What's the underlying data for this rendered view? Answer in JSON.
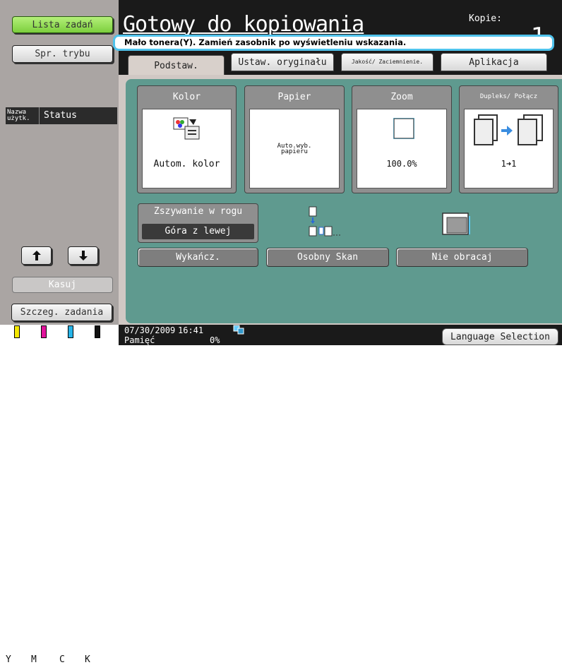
{
  "sidebar": {
    "job_list_label": "Lista zadań",
    "mode_check_label": "Spr. trybu",
    "user_col_label": "Nazwa użytk.",
    "status_col_label": "Status",
    "delete_label": "Kasuj",
    "job_details_label": "Szczeg. zadania",
    "toner": [
      {
        "letter": "Y",
        "color": "#f5e800"
      },
      {
        "letter": "M",
        "color": "#e0139b"
      },
      {
        "letter": "C",
        "color": "#27b4e8"
      },
      {
        "letter": "K",
        "color": "#111111"
      }
    ]
  },
  "header": {
    "title": "Gotowy do kopiowania",
    "copies_label": "Kopie:",
    "copies_value": "1",
    "message": "Mało tonera(Y). Zamień zasobnik po wyświetleniu wskazania."
  },
  "tabs": [
    {
      "label": "Podstaw.",
      "selected": true
    },
    {
      "label": "Ustaw. oryginału",
      "selected": false
    },
    {
      "label": "Jakość/ Zaciemnienie.",
      "selected": false
    },
    {
      "label": "Aplikacja",
      "selected": false
    }
  ],
  "functions": {
    "color": {
      "title": "Kolor",
      "value": "Autom. kolor"
    },
    "paper": {
      "title": "Papier",
      "value": "Auto.wyb. papieru"
    },
    "zoom": {
      "title": "Zoom",
      "value": "100.0%"
    },
    "duplex": {
      "title": "Dupleks/ Połącz",
      "value": "1➜1"
    }
  },
  "staple": {
    "title": "Zszywanie w rogu",
    "value": "Góra z lewej"
  },
  "actions": {
    "finishing_label": "Wykańcz.",
    "separate_scan_label": "Osobny Skan",
    "no_rotate_label": "Nie obracaj"
  },
  "status_bar": {
    "date": "07/30/2009",
    "time": "16:41",
    "memory_label": "Pamięć",
    "memory_value": "0%",
    "language_label": "Language Selection"
  },
  "colors": {
    "accent_green": "#8ee04f",
    "panel_teal": "#5f9a8f",
    "message_border": "#4fc3ec"
  }
}
